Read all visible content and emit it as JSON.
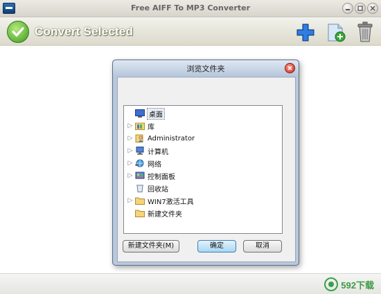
{
  "window": {
    "title": "Free AIFF To MP3 Converter"
  },
  "toolbar": {
    "convert_label": "Convert Selected"
  },
  "dialog": {
    "title": "浏览文件夹",
    "tree": [
      {
        "label": "桌面",
        "icon": "desktop-icon",
        "expandable": false,
        "selected": true
      },
      {
        "label": "库",
        "icon": "library-icon",
        "expandable": true,
        "selected": false
      },
      {
        "label": "Administrator",
        "icon": "user-folder-icon",
        "expandable": true,
        "selected": false
      },
      {
        "label": "计算机",
        "icon": "computer-icon",
        "expandable": true,
        "selected": false
      },
      {
        "label": "网络",
        "icon": "network-icon",
        "expandable": true,
        "selected": false
      },
      {
        "label": "控制面板",
        "icon": "control-panel-icon",
        "expandable": true,
        "selected": false
      },
      {
        "label": "回收站",
        "icon": "recycle-bin-icon",
        "expandable": false,
        "selected": false
      },
      {
        "label": "WIN7激活工具",
        "icon": "folder-icon",
        "expandable": true,
        "selected": false
      },
      {
        "label": "新建文件夹",
        "icon": "folder-icon",
        "expandable": false,
        "selected": false
      }
    ],
    "buttons": {
      "new_folder": "新建文件夹(M)",
      "ok": "确定",
      "cancel": "取消"
    }
  },
  "watermark": {
    "text": "592下载"
  }
}
